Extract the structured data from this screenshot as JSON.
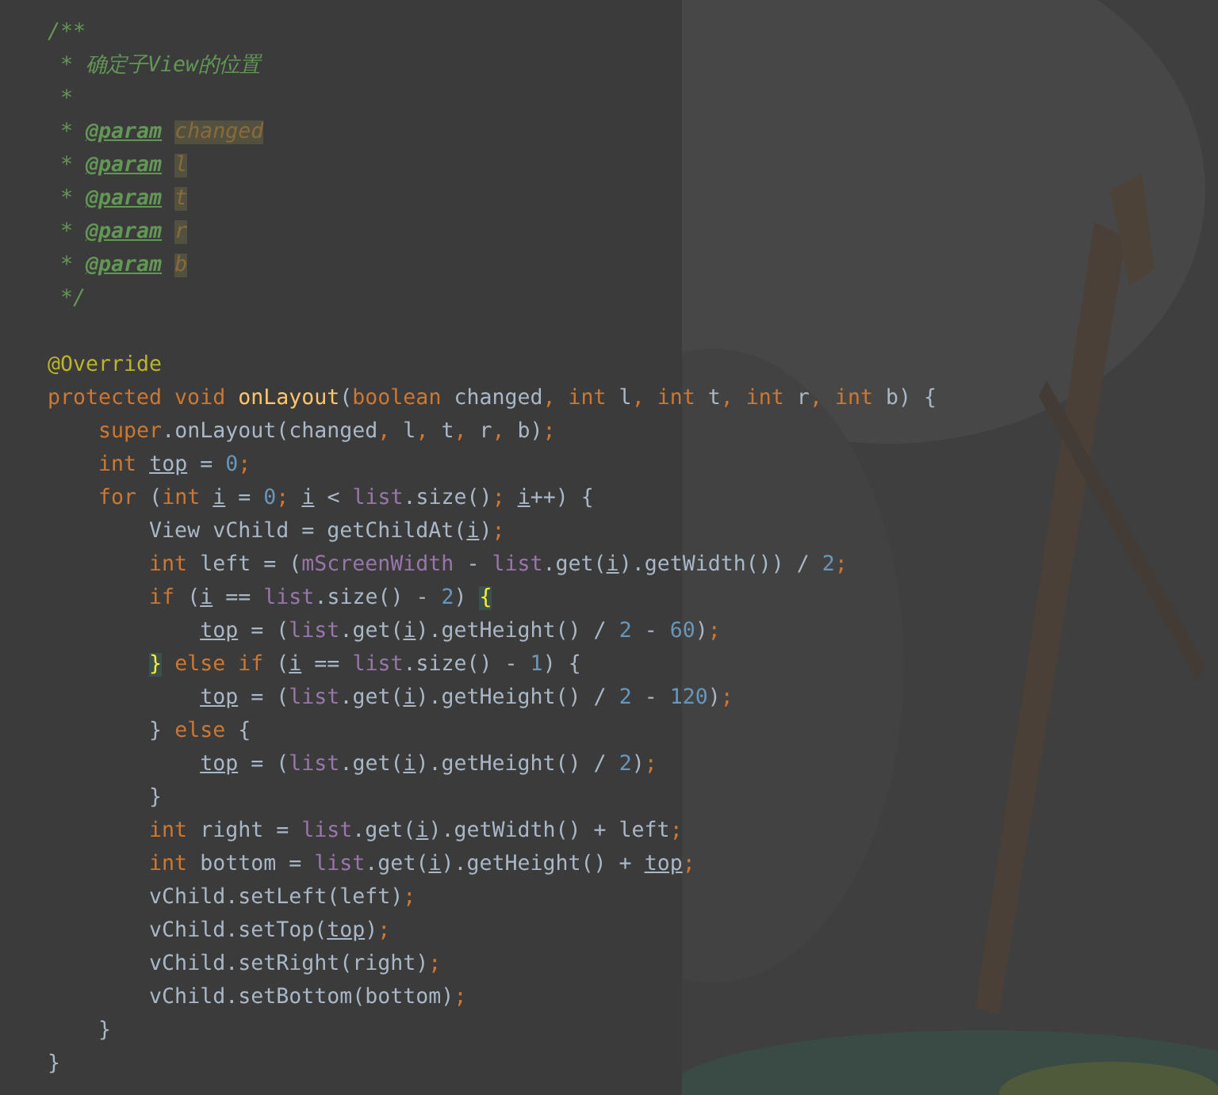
{
  "editor": {
    "lines": [
      {
        "kind": "code",
        "tokens": [
          {
            "text": "/**",
            "kind": "comment"
          }
        ]
      },
      {
        "kind": "code",
        "tokens": [
          {
            "text": " * 确定子View的位置",
            "kind": "comment"
          }
        ]
      },
      {
        "kind": "code",
        "tokens": [
          {
            "text": " *",
            "kind": "comment"
          }
        ]
      },
      {
        "kind": "code",
        "tokens": [
          {
            "text": " * ",
            "kind": "comment"
          },
          {
            "text": "@param",
            "kind": "tag"
          },
          {
            "text": " changed",
            "kind": "param"
          }
        ]
      },
      {
        "kind": "code",
        "tokens": [
          {
            "text": " * ",
            "kind": "comment"
          },
          {
            "text": "@param",
            "kind": "tag"
          },
          {
            "text": " l",
            "kind": "param"
          }
        ]
      },
      {
        "kind": "code",
        "tokens": [
          {
            "text": " * ",
            "kind": "comment"
          },
          {
            "text": "@param",
            "kind": "tag"
          },
          {
            "text": " t",
            "kind": "param"
          }
        ]
      },
      {
        "kind": "code",
        "tokens": [
          {
            "text": " * ",
            "kind": "comment"
          },
          {
            "text": "@param",
            "kind": "tag"
          },
          {
            "text": " r",
            "kind": "param"
          }
        ]
      },
      {
        "kind": "code",
        "tokens": [
          {
            "text": " * ",
            "kind": "comment"
          },
          {
            "text": "@param",
            "kind": "tag"
          },
          {
            "text": " b",
            "kind": "param"
          }
        ]
      },
      {
        "kind": "code",
        "tokens": [
          {
            "text": " */",
            "kind": "comment"
          }
        ]
      },
      {
        "kind": "blank"
      },
      {
        "kind": "code",
        "tokens": [
          {
            "text": "@Override",
            "kind": "annotation"
          }
        ]
      },
      {
        "kind": "code",
        "tokens": [
          {
            "text": "protected void ",
            "kind": "keyword"
          },
          {
            "text": "onLayout",
            "kind": "method"
          },
          {
            "text": "(",
            "kind": "plain"
          },
          {
            "text": "boolean ",
            "kind": "keyword"
          },
          {
            "text": "changed",
            "kind": "plain"
          },
          {
            "text": ", int ",
            "kind": "keyword"
          },
          {
            "text": "l",
            "kind": "plain"
          },
          {
            "text": ", int ",
            "kind": "keyword"
          },
          {
            "text": "t",
            "kind": "plain"
          },
          {
            "text": ", int ",
            "kind": "keyword"
          },
          {
            "text": "r",
            "kind": "plain"
          },
          {
            "text": ", int ",
            "kind": "keyword"
          },
          {
            "text": "b) {",
            "kind": "plain"
          }
        ]
      },
      {
        "kind": "code",
        "tokens": [
          {
            "text": "    super",
            "kind": "keyword"
          },
          {
            "text": ".onLayout(changed",
            "kind": "plain"
          },
          {
            "text": ", ",
            "kind": "keyword"
          },
          {
            "text": "l",
            "kind": "plain"
          },
          {
            "text": ", ",
            "kind": "keyword"
          },
          {
            "text": "t",
            "kind": "plain"
          },
          {
            "text": ", ",
            "kind": "keyword"
          },
          {
            "text": "r",
            "kind": "plain"
          },
          {
            "text": ", ",
            "kind": "keyword"
          },
          {
            "text": "b)",
            "kind": "plain"
          },
          {
            "text": ";",
            "kind": "keyword"
          }
        ]
      },
      {
        "kind": "code",
        "tokens": [
          {
            "text": "    int ",
            "kind": "keyword"
          },
          {
            "text": "top",
            "kind": "variable"
          },
          {
            "text": " = ",
            "kind": "plain"
          },
          {
            "text": "0",
            "kind": "number"
          },
          {
            "text": ";",
            "kind": "keyword"
          }
        ]
      },
      {
        "kind": "code",
        "tokens": [
          {
            "text": "    for ",
            "kind": "keyword"
          },
          {
            "text": "(",
            "kind": "plain"
          },
          {
            "text": "int ",
            "kind": "keyword"
          },
          {
            "text": "i",
            "kind": "variable"
          },
          {
            "text": " = ",
            "kind": "plain"
          },
          {
            "text": "0",
            "kind": "number"
          },
          {
            "text": "; ",
            "kind": "keyword"
          },
          {
            "text": "i",
            "kind": "variable"
          },
          {
            "text": " < ",
            "kind": "plain"
          },
          {
            "text": "list",
            "kind": "field"
          },
          {
            "text": ".size()",
            "kind": "plain"
          },
          {
            "text": "; ",
            "kind": "keyword"
          },
          {
            "text": "i",
            "kind": "variable"
          },
          {
            "text": "++) {",
            "kind": "plain"
          }
        ]
      },
      {
        "kind": "code",
        "tokens": [
          {
            "text": "        View vChild = getChildAt(",
            "kind": "plain"
          },
          {
            "text": "i",
            "kind": "variable"
          },
          {
            "text": ")",
            "kind": "plain"
          },
          {
            "text": ";",
            "kind": "keyword"
          }
        ]
      },
      {
        "kind": "code",
        "tokens": [
          {
            "text": "        int ",
            "kind": "keyword"
          },
          {
            "text": "left = (",
            "kind": "plain"
          },
          {
            "text": "mScreenWidth",
            "kind": "field"
          },
          {
            "text": " - ",
            "kind": "plain"
          },
          {
            "text": "list",
            "kind": "field"
          },
          {
            "text": ".get(",
            "kind": "plain"
          },
          {
            "text": "i",
            "kind": "variable"
          },
          {
            "text": ").getWidth()) / ",
            "kind": "plain"
          },
          {
            "text": "2",
            "kind": "number"
          },
          {
            "text": ";",
            "kind": "keyword"
          }
        ]
      },
      {
        "kind": "code",
        "tokens": [
          {
            "text": "        if ",
            "kind": "keyword"
          },
          {
            "text": "(",
            "kind": "plain"
          },
          {
            "text": "i",
            "kind": "variable"
          },
          {
            "text": " == ",
            "kind": "plain"
          },
          {
            "text": "list",
            "kind": "field"
          },
          {
            "text": ".size() - ",
            "kind": "plain"
          },
          {
            "text": "2",
            "kind": "number"
          },
          {
            "text": ") ",
            "kind": "plain"
          },
          {
            "text": "{",
            "kind": "brace_match"
          }
        ]
      },
      {
        "kind": "code",
        "tokens": [
          {
            "text": "            top",
            "kind": "variable"
          },
          {
            "text": " = (",
            "kind": "plain"
          },
          {
            "text": "list",
            "kind": "field"
          },
          {
            "text": ".get(",
            "kind": "plain"
          },
          {
            "text": "i",
            "kind": "variable"
          },
          {
            "text": ").getHeight() / ",
            "kind": "plain"
          },
          {
            "text": "2",
            "kind": "number"
          },
          {
            "text": " - ",
            "kind": "plain"
          },
          {
            "text": "60",
            "kind": "number"
          },
          {
            "text": ")",
            "kind": "plain"
          },
          {
            "text": ";",
            "kind": "keyword"
          }
        ]
      },
      {
        "kind": "code",
        "tokens": [
          {
            "text": "        }",
            "kind": "brace_match"
          },
          {
            "text": " else if ",
            "kind": "keyword"
          },
          {
            "text": "(",
            "kind": "plain"
          },
          {
            "text": "i",
            "kind": "variable"
          },
          {
            "text": " == ",
            "kind": "plain"
          },
          {
            "text": "list",
            "kind": "field"
          },
          {
            "text": ".size() - ",
            "kind": "plain"
          },
          {
            "text": "1",
            "kind": "number"
          },
          {
            "text": ") {",
            "kind": "plain"
          }
        ]
      },
      {
        "kind": "code",
        "tokens": [
          {
            "text": "            top",
            "kind": "variable"
          },
          {
            "text": " = (",
            "kind": "plain"
          },
          {
            "text": "list",
            "kind": "field"
          },
          {
            "text": ".get(",
            "kind": "plain"
          },
          {
            "text": "i",
            "kind": "variable"
          },
          {
            "text": ").getHeight() / ",
            "kind": "plain"
          },
          {
            "text": "2",
            "kind": "number"
          },
          {
            "text": " - ",
            "kind": "plain"
          },
          {
            "text": "120",
            "kind": "number"
          },
          {
            "text": ")",
            "kind": "plain"
          },
          {
            "text": ";",
            "kind": "keyword"
          }
        ]
      },
      {
        "kind": "code",
        "tokens": [
          {
            "text": "        } ",
            "kind": "plain"
          },
          {
            "text": "else ",
            "kind": "keyword"
          },
          {
            "text": "{",
            "kind": "plain"
          }
        ]
      },
      {
        "kind": "code",
        "tokens": [
          {
            "text": "            top",
            "kind": "variable"
          },
          {
            "text": " = (",
            "kind": "plain"
          },
          {
            "text": "list",
            "kind": "field"
          },
          {
            "text": ".get(",
            "kind": "plain"
          },
          {
            "text": "i",
            "kind": "variable"
          },
          {
            "text": ").getHeight() / ",
            "kind": "plain"
          },
          {
            "text": "2",
            "kind": "number"
          },
          {
            "text": ")",
            "kind": "plain"
          },
          {
            "text": ";",
            "kind": "keyword"
          }
        ]
      },
      {
        "kind": "code",
        "tokens": [
          {
            "text": "        }",
            "kind": "plain"
          }
        ]
      },
      {
        "kind": "code",
        "tokens": [
          {
            "text": "        int ",
            "kind": "keyword"
          },
          {
            "text": "right = ",
            "kind": "plain"
          },
          {
            "text": "list",
            "kind": "field"
          },
          {
            "text": ".get(",
            "kind": "plain"
          },
          {
            "text": "i",
            "kind": "variable"
          },
          {
            "text": ").getWidth() + left",
            "kind": "plain"
          },
          {
            "text": ";",
            "kind": "keyword"
          }
        ]
      },
      {
        "kind": "code",
        "tokens": [
          {
            "text": "        int ",
            "kind": "keyword"
          },
          {
            "text": "bottom = ",
            "kind": "plain"
          },
          {
            "text": "list",
            "kind": "field"
          },
          {
            "text": ".get(",
            "kind": "plain"
          },
          {
            "text": "i",
            "kind": "variable"
          },
          {
            "text": ").getHeight() + ",
            "kind": "plain"
          },
          {
            "text": "top",
            "kind": "variable"
          },
          {
            "text": ";",
            "kind": "keyword"
          }
        ]
      },
      {
        "kind": "code",
        "tokens": [
          {
            "text": "        vChild.setLeft(left)",
            "kind": "plain"
          },
          {
            "text": ";",
            "kind": "keyword"
          }
        ]
      },
      {
        "kind": "code",
        "tokens": [
          {
            "text": "        vChild.setTop(",
            "kind": "plain"
          },
          {
            "text": "top",
            "kind": "variable"
          },
          {
            "text": ")",
            "kind": "plain"
          },
          {
            "text": ";",
            "kind": "keyword"
          }
        ]
      },
      {
        "kind": "code",
        "tokens": [
          {
            "text": "        vChild.setRight(right)",
            "kind": "plain"
          },
          {
            "text": ";",
            "kind": "keyword"
          }
        ]
      },
      {
        "kind": "code",
        "tokens": [
          {
            "text": "        vChild.setBottom(bottom)",
            "kind": "plain"
          },
          {
            "text": ";",
            "kind": "keyword"
          }
        ]
      },
      {
        "kind": "code",
        "tokens": [
          {
            "text": "    }",
            "kind": "plain"
          }
        ]
      },
      {
        "kind": "code",
        "tokens": [
          {
            "text": "}",
            "kind": "plain"
          }
        ]
      }
    ]
  }
}
